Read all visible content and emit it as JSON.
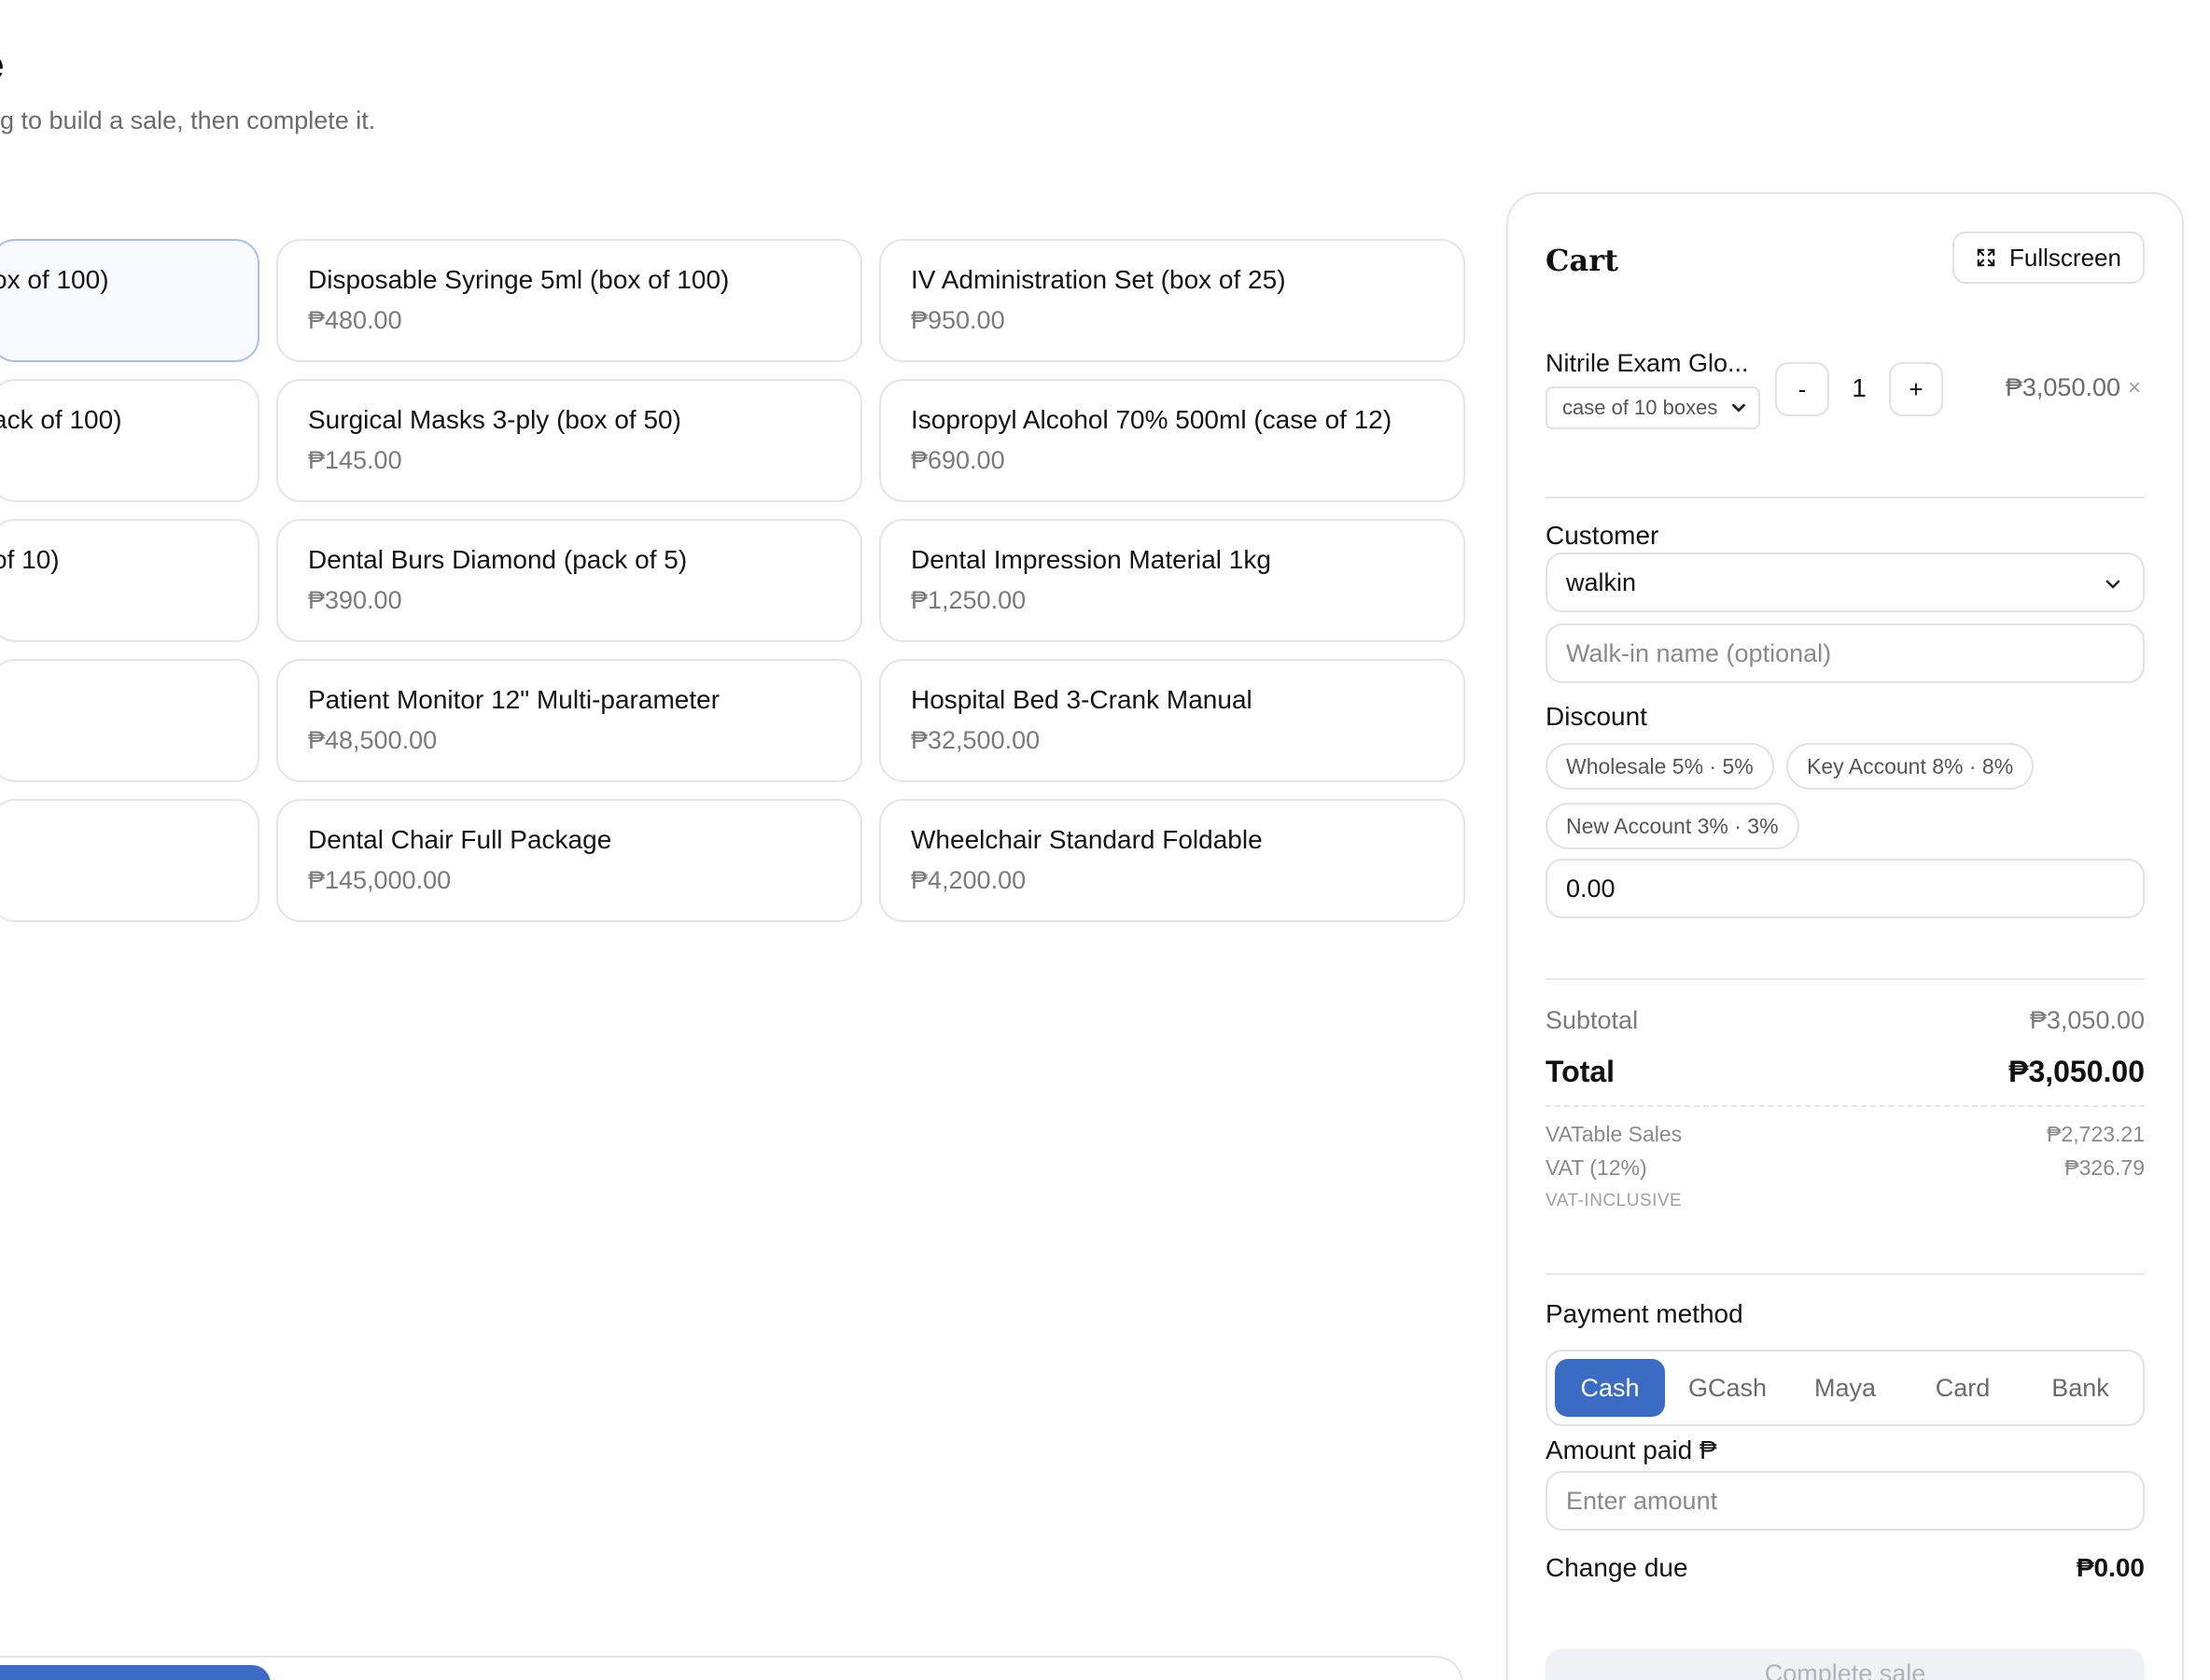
{
  "page": {
    "title": "e",
    "subtitle": "g to build a sale, then complete it."
  },
  "products": [
    {
      "name": "ox of 100)",
      "price": ""
    },
    {
      "name": "Disposable Syringe 5ml (box of 100)",
      "price": "₱480.00"
    },
    {
      "name": "IV Administration Set (box of 25)",
      "price": "₱950.00"
    },
    {
      "name": "ack of 100)",
      "price": ""
    },
    {
      "name": "Surgical Masks 3-ply (box of 50)",
      "price": "₱145.00"
    },
    {
      "name": "Isopropyl Alcohol 70% 500ml (case of 12)",
      "price": "₱690.00"
    },
    {
      "name": "of 10)",
      "price": ""
    },
    {
      "name": "Dental Burs Diamond (pack of 5)",
      "price": "₱390.00"
    },
    {
      "name": "Dental Impression Material 1kg",
      "price": "₱1,250.00"
    },
    {
      "name": "",
      "price": ""
    },
    {
      "name": "Patient Monitor 12\" Multi-parameter",
      "price": "₱48,500.00"
    },
    {
      "name": "Hospital Bed 3-Crank Manual",
      "price": "₱32,500.00"
    },
    {
      "name": "",
      "price": ""
    },
    {
      "name": "Dental Chair Full Package",
      "price": "₱145,000.00"
    },
    {
      "name": "Wheelchair Standard Foldable",
      "price": "₱4,200.00"
    }
  ],
  "cart": {
    "title": "Cart",
    "fullscreen_label": "Fullscreen",
    "item": {
      "name": "Nitrile Exam Glo...",
      "unit": "case of 10 boxes",
      "qty": "1",
      "minus": "-",
      "plus": "+",
      "line_total": "₱3,050.00",
      "remove": "×"
    },
    "customer_label": "Customer",
    "customer_value": "walkin",
    "walkin_placeholder": "Walk-in name (optional)",
    "discount_label": "Discount",
    "discount_chips": [
      "Wholesale 5% · 5%",
      "Key Account 8% · 8%",
      "New Account 3% · 3%"
    ],
    "discount_value": "0.00",
    "subtotal_label": "Subtotal",
    "subtotal_value": "₱3,050.00",
    "total_label": "Total",
    "total_value": "₱3,050.00",
    "vatable_label": "VATable Sales",
    "vatable_value": "₱2,723.21",
    "vat_label": "VAT (12%)",
    "vat_value": "₱326.79",
    "vat_note": "VAT-INCLUSIVE",
    "payment_label": "Payment method",
    "payment_methods": [
      "Cash",
      "GCash",
      "Maya",
      "Card",
      "Bank"
    ],
    "payment_selected": "Cash",
    "amount_label": "Amount paid ₱",
    "amount_placeholder": "Enter amount",
    "change_label": "Change due",
    "change_value": "₱0.00",
    "complete_label": "Complete sale"
  },
  "colors": {
    "accent": "#3b6cc4",
    "border": "#e3e5ea",
    "muted_text": "#7a7a7a"
  },
  "icons": {
    "fullscreen": "expand-corners-icon",
    "dropdown": "chevron-down-icon",
    "remove": "close-icon"
  }
}
